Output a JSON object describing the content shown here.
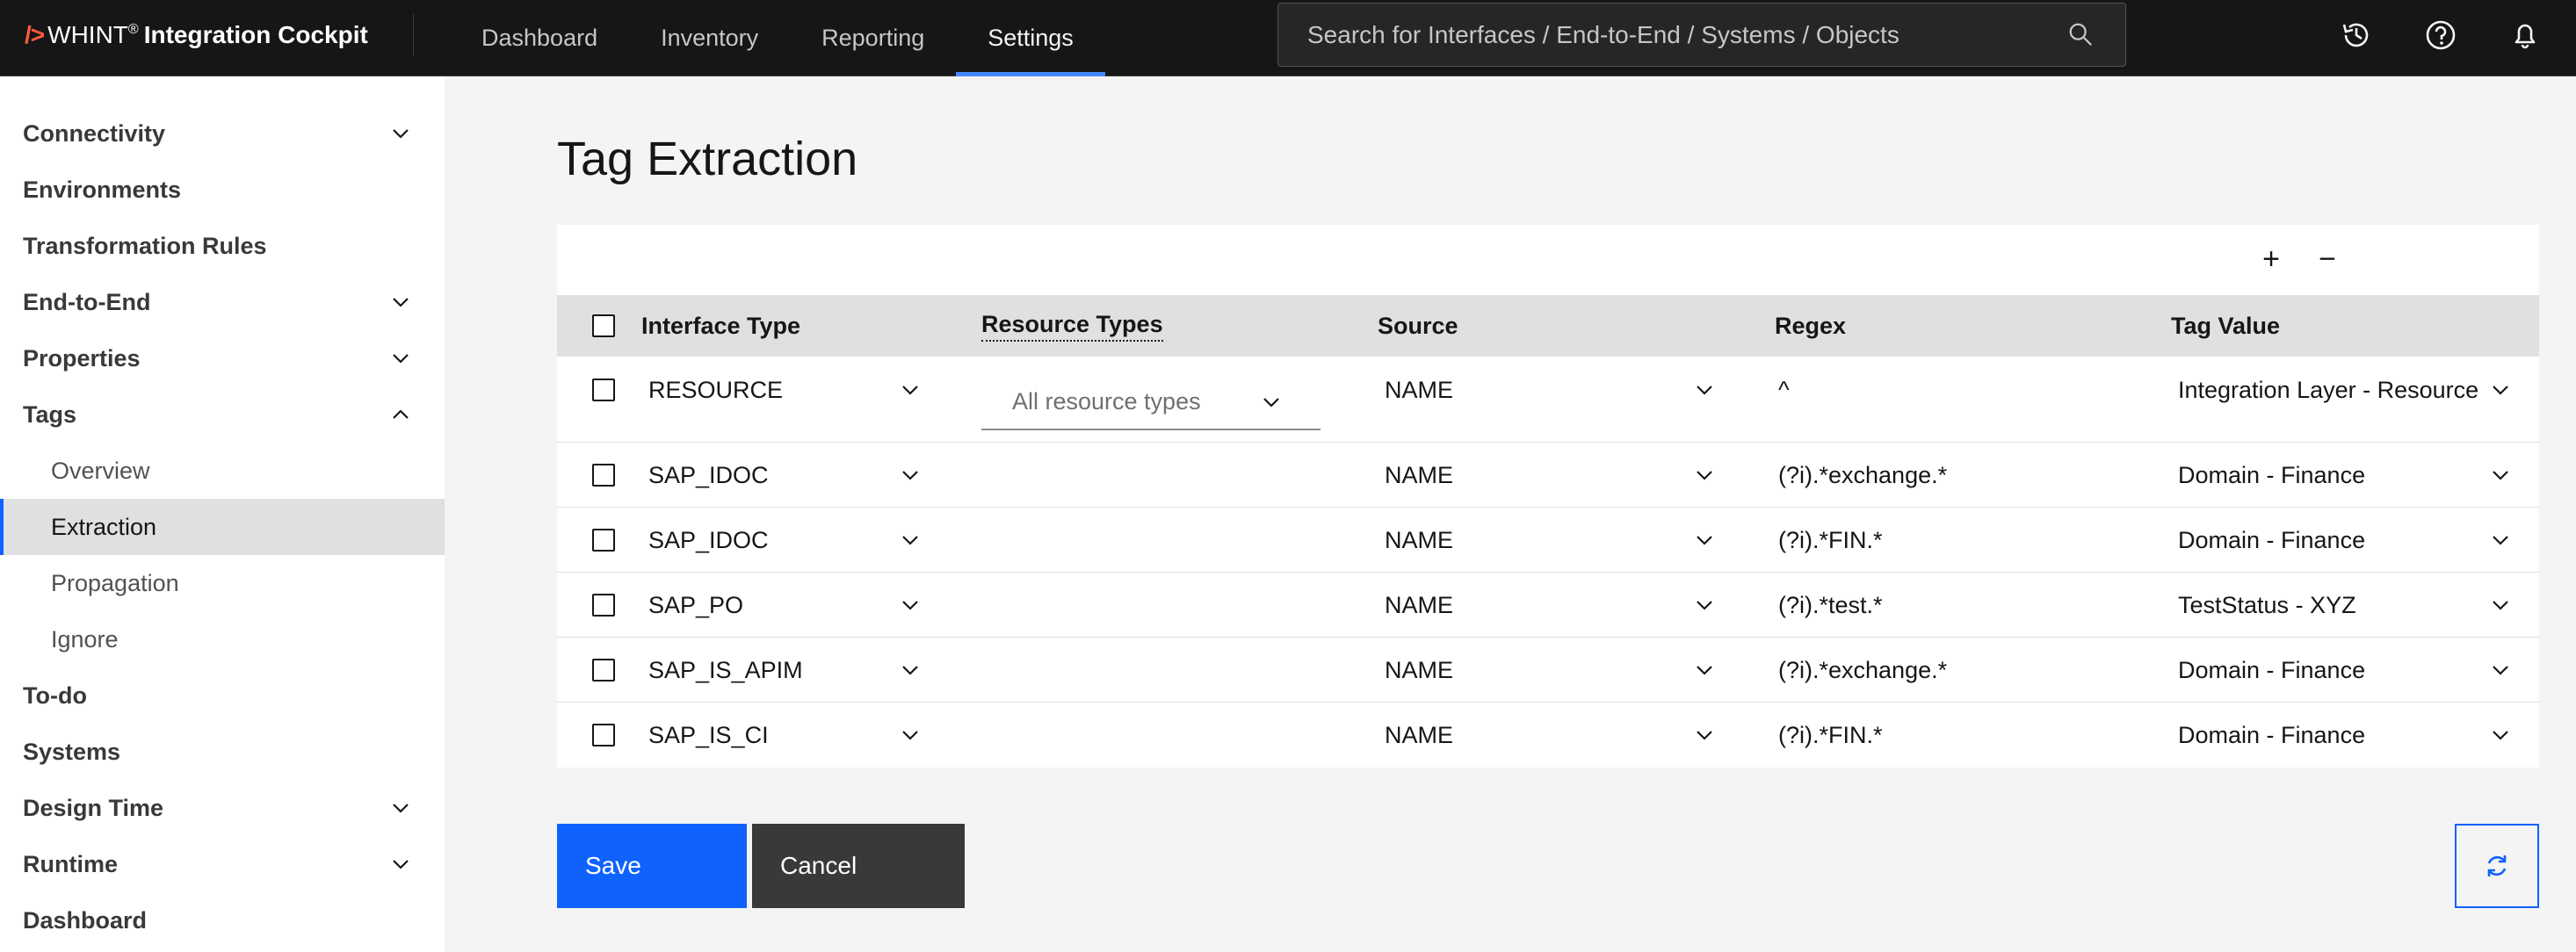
{
  "header": {
    "brand_mark": "/>",
    "brand_name": "WHINT",
    "brand_reg": "®",
    "brand_product": "Integration Cockpit",
    "nav": [
      {
        "label": "Dashboard"
      },
      {
        "label": "Inventory"
      },
      {
        "label": "Reporting"
      },
      {
        "label": "Settings",
        "active": true
      }
    ],
    "search_placeholder": "Search for Interfaces / End-to-End / Systems / Objects",
    "icons": [
      "history-icon",
      "help-icon",
      "notification-icon"
    ]
  },
  "sidebar": {
    "items": [
      {
        "label": "Connectivity",
        "expandable": true,
        "expanded": false
      },
      {
        "label": "Environments"
      },
      {
        "label": "Transformation Rules"
      },
      {
        "label": "End-to-End",
        "expandable": true,
        "expanded": false
      },
      {
        "label": "Properties",
        "expandable": true,
        "expanded": false
      },
      {
        "label": "Tags",
        "expandable": true,
        "expanded": true
      },
      {
        "label": "Overview",
        "sub": true
      },
      {
        "label": "Extraction",
        "sub": true,
        "selected": true
      },
      {
        "label": "Propagation",
        "sub": true
      },
      {
        "label": "Ignore",
        "sub": true
      },
      {
        "label": "To-do"
      },
      {
        "label": "Systems"
      },
      {
        "label": "Design Time",
        "expandable": true,
        "expanded": false
      },
      {
        "label": "Runtime",
        "expandable": true,
        "expanded": false
      },
      {
        "label": "Dashboard"
      }
    ]
  },
  "main": {
    "title": "Tag Extraction",
    "toolbar": {
      "add": "+",
      "remove": "−"
    },
    "columns": [
      "Interface Type",
      "Resource Types",
      "Source",
      "Regex",
      "Tag Value"
    ],
    "resource_placeholder": "All resource types",
    "rows": [
      {
        "interface_type": "RESOURCE",
        "source": "NAME",
        "regex": "^",
        "tag_value": "Integration Layer - Resource"
      },
      {
        "interface_type": "SAP_IDOC",
        "source": "NAME",
        "regex": "(?i).*exchange.*",
        "tag_value": "Domain - Finance"
      },
      {
        "interface_type": "SAP_IDOC",
        "source": "NAME",
        "regex": "(?i).*FIN.*",
        "tag_value": "Domain - Finance"
      },
      {
        "interface_type": "SAP_PO",
        "source": "NAME",
        "regex": "(?i).*test.*",
        "tag_value": "TestStatus - XYZ"
      },
      {
        "interface_type": "SAP_IS_APIM",
        "source": "NAME",
        "regex": "(?i).*exchange.*",
        "tag_value": "Domain - Finance"
      },
      {
        "interface_type": "SAP_IS_CI",
        "source": "NAME",
        "regex": "(?i).*FIN.*",
        "tag_value": "Domain - Finance"
      }
    ],
    "buttons": {
      "save": "Save",
      "cancel": "Cancel"
    }
  },
  "colors": {
    "primary": "#0f62fe",
    "header_bg": "#161616",
    "brand_accent": "#ff5a3c"
  }
}
